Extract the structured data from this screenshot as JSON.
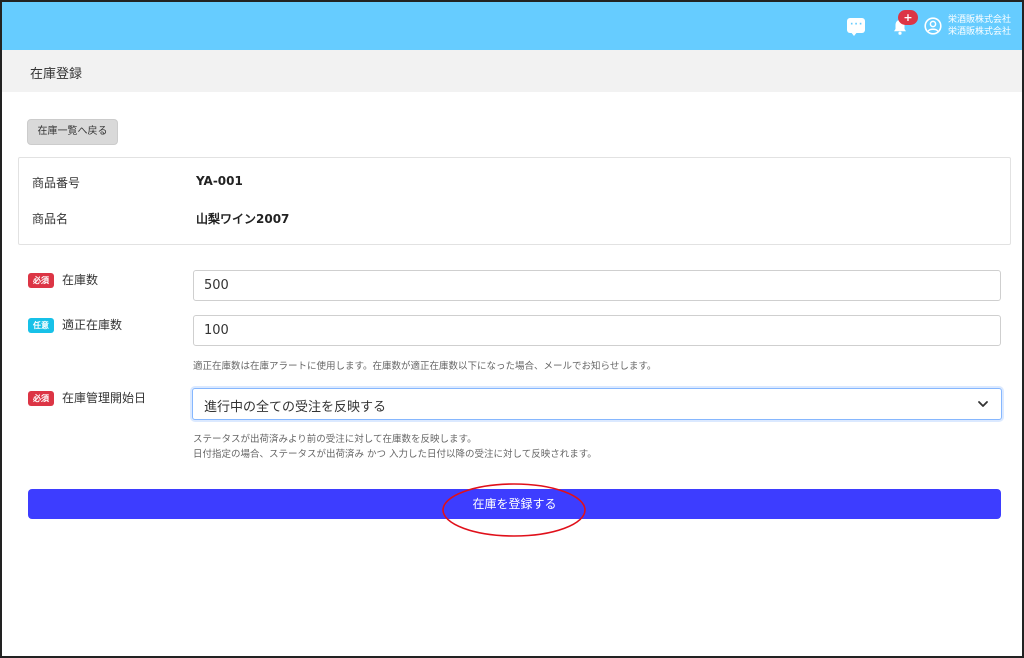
{
  "header": {
    "notification_count": "+",
    "company_line1": "栄酒販株式会社",
    "company_line2": "栄酒販株式会社",
    "icons": [
      "chat-icon",
      "bell-icon",
      "user-circle-icon"
    ],
    "bg_color": "#66ccff"
  },
  "page": {
    "title": "在庫登録",
    "back_button": "在庫一覧へ戻る"
  },
  "product": {
    "number_label": "商品番号",
    "number_value": "YA-001",
    "name_label": "商品名",
    "name_value": "山梨ワイン2007"
  },
  "form": {
    "required_badge": "必須",
    "optional_badge": "任意",
    "stock_label": "在庫数",
    "stock_value": "500",
    "proper_stock_label": "適正在庫数",
    "proper_stock_value": "100",
    "proper_stock_help": "適正在庫数は在庫アラートに使用します。在庫数が適正在庫数以下になった場合、メールでお知らせします。",
    "start_date_label": "在庫管理開始日",
    "start_date_selected": "進行中の全ての受注を反映する",
    "start_date_help1": "ステータスが出荷済みより前の受注に対して在庫数を反映します。",
    "start_date_help2": "日付指定の場合、ステータスが出荷済み かつ 入力した日付以降の受注に対して反映されます。",
    "submit_label": "在庫を登録する"
  },
  "colors": {
    "required": "#dc3545",
    "optional": "#17c1e8",
    "submit": "#3d3dff",
    "annotation": "#e0101a"
  }
}
